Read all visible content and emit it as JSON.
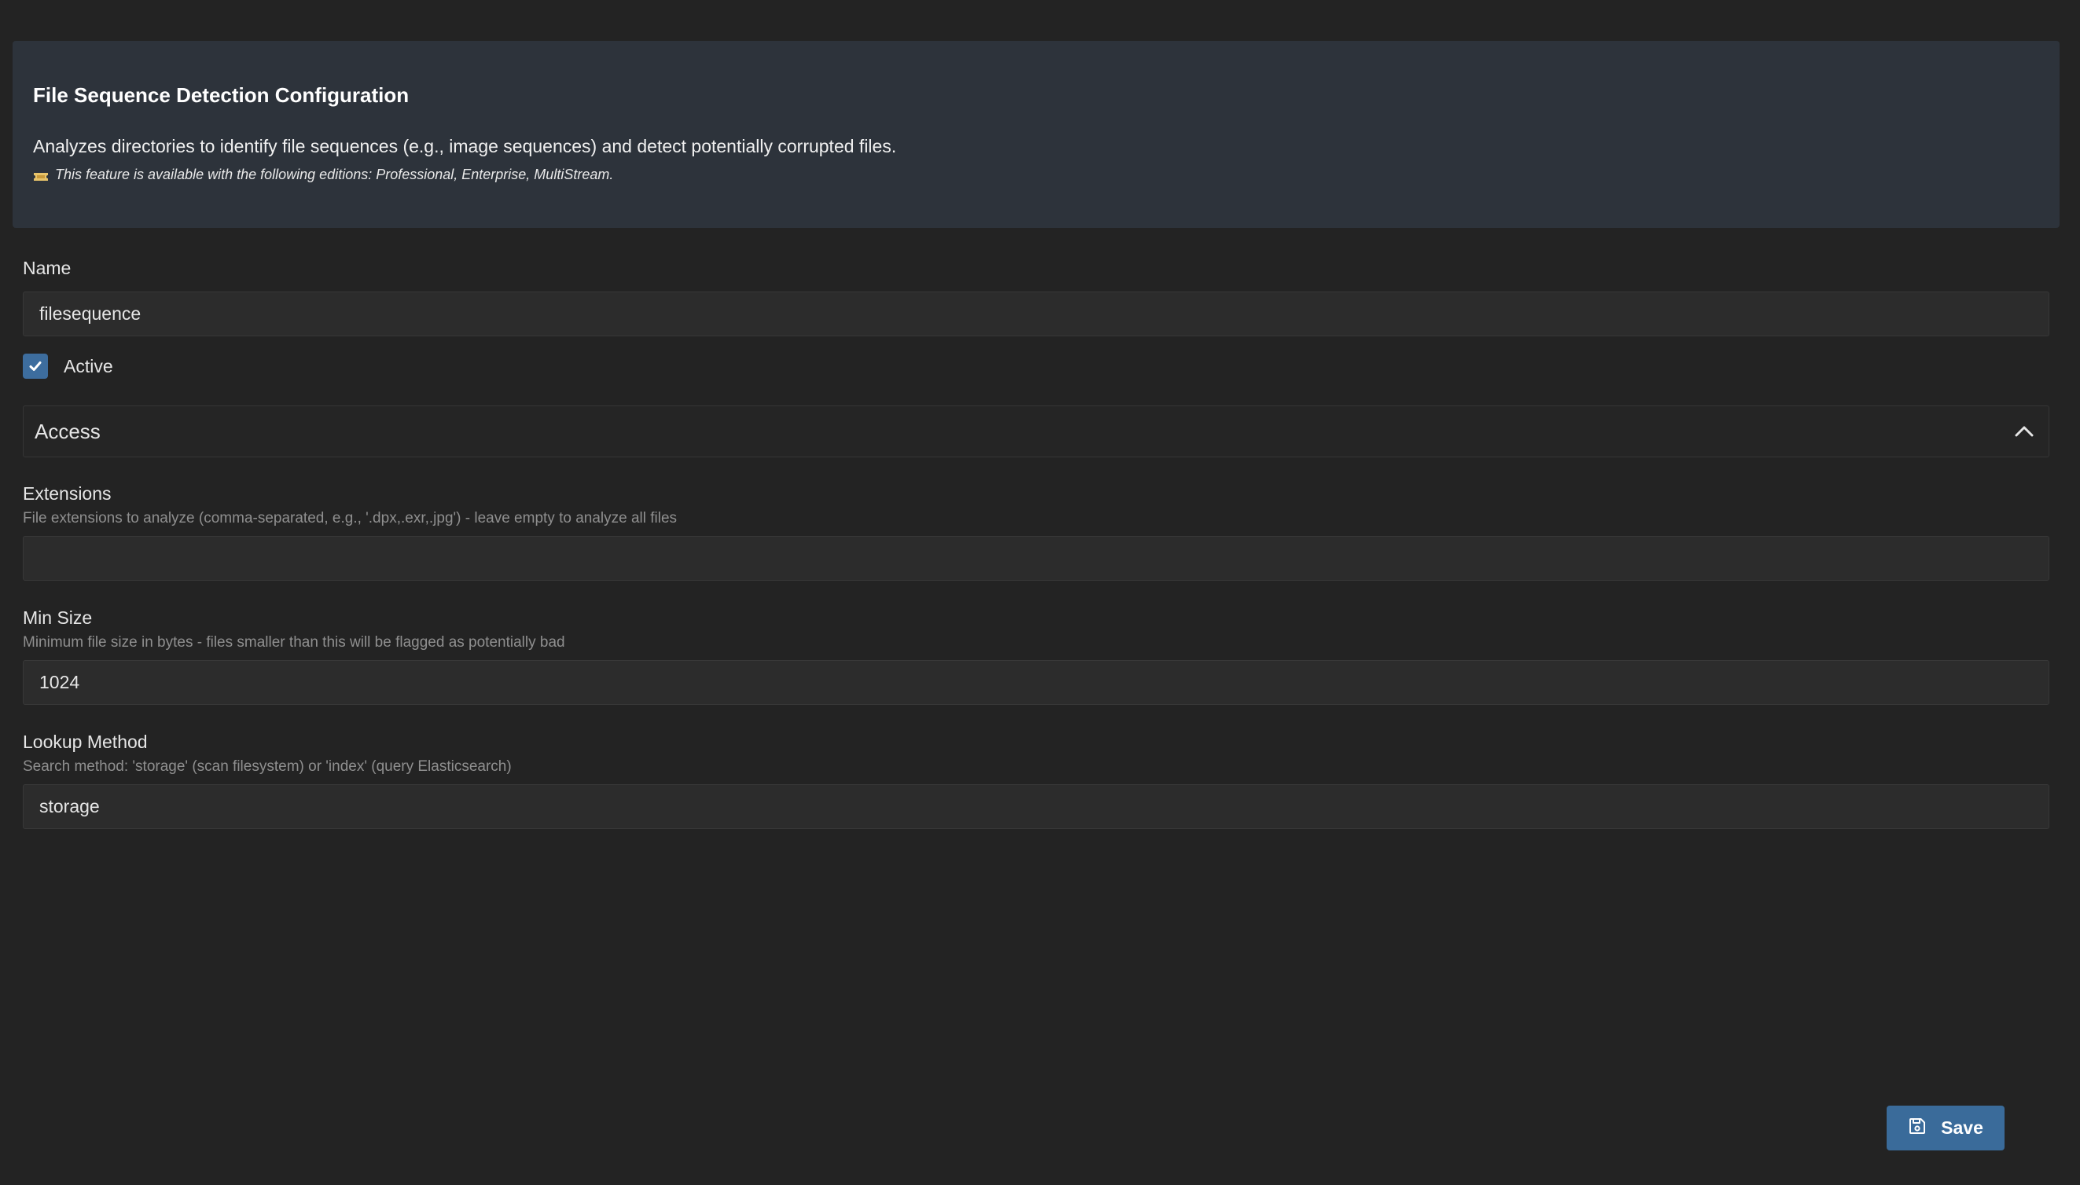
{
  "header": {
    "title": "File Sequence Detection Configuration",
    "description": "Analyzes directories to identify file sequences (e.g., image sequences) and detect potentially corrupted files.",
    "edition_icon": "ticket-icon",
    "edition_note": "This feature is available with the following editions: Professional, Enterprise, MultiStream."
  },
  "form": {
    "name": {
      "label": "Name",
      "value": "filesequence"
    },
    "active": {
      "label": "Active",
      "checked": true
    },
    "access": {
      "title": "Access",
      "expanded": true,
      "icon": "chevron-up-icon"
    },
    "extensions": {
      "label": "Extensions",
      "help": "File extensions to analyze (comma-separated, e.g., '.dpx,.exr,.jpg') - leave empty to analyze all files",
      "value": ""
    },
    "min_size": {
      "label": "Min Size",
      "help": "Minimum file size in bytes - files smaller than this will be flagged as potentially bad",
      "value": "1024"
    },
    "lookup_method": {
      "label": "Lookup Method",
      "help": "Search method: 'storage' (scan filesystem) or 'index' (query Elasticsearch)",
      "value": "storage"
    }
  },
  "actions": {
    "save_label": "Save",
    "save_icon": "save-icon"
  },
  "colors": {
    "background": "#232323",
    "panel": "#2d333b",
    "accent": "#3a6b9a"
  }
}
